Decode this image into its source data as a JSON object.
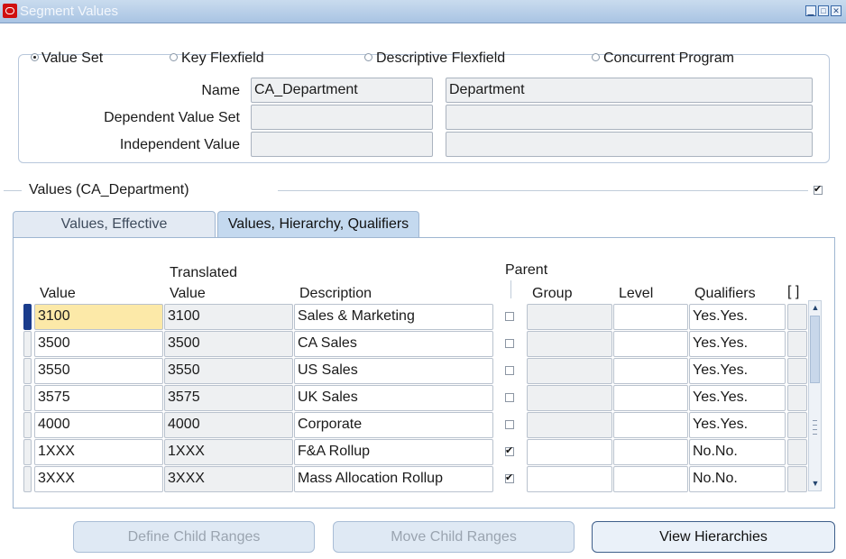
{
  "window": {
    "title": "Segment Values"
  },
  "selector": {
    "options": [
      {
        "label": "Value Set",
        "selected": true
      },
      {
        "label": "Key Flexfield",
        "selected": false
      },
      {
        "label": "Descriptive Flexfield",
        "selected": false
      },
      {
        "label": "Concurrent Program",
        "selected": false
      }
    ],
    "fields": [
      {
        "label": "Name",
        "value": "CA_Department",
        "description": "Department"
      },
      {
        "label": "Dependent Value Set",
        "value": "",
        "description": ""
      },
      {
        "label": "Independent Value",
        "value": "",
        "description": ""
      }
    ]
  },
  "values": {
    "title": "Values (CA_Department)",
    "tabs": [
      {
        "label": "Values, Effective",
        "active": false
      },
      {
        "label": "Values, Hierarchy, Qualifiers",
        "active": true
      }
    ],
    "headers": {
      "value": "Value",
      "translated_1": "Translated",
      "translated_2": "Value",
      "description": "Description",
      "parent": "Parent",
      "group": "Group",
      "level": "Level",
      "qualifiers": "Qualifiers",
      "extra": "[ ]"
    },
    "rows": [
      {
        "value": "3100",
        "translated": "3100",
        "description": "Sales & Marketing",
        "parent": false,
        "group": "",
        "level": "",
        "qualifiers": "Yes.Yes."
      },
      {
        "value": "3500",
        "translated": "3500",
        "description": "CA Sales",
        "parent": false,
        "group": "",
        "level": "",
        "qualifiers": "Yes.Yes."
      },
      {
        "value": "3550",
        "translated": "3550",
        "description": "US Sales",
        "parent": false,
        "group": "",
        "level": "",
        "qualifiers": "Yes.Yes."
      },
      {
        "value": "3575",
        "translated": "3575",
        "description": "UK Sales",
        "parent": false,
        "group": "",
        "level": "",
        "qualifiers": "Yes.Yes."
      },
      {
        "value": "4000",
        "translated": "4000",
        "description": "Corporate",
        "parent": false,
        "group": "",
        "level": "",
        "qualifiers": "Yes.Yes."
      },
      {
        "value": "1XXX",
        "translated": "1XXX",
        "description": "F&A Rollup",
        "parent": true,
        "group": "",
        "level": "",
        "qualifiers": "No.No."
      },
      {
        "value": "3XXX",
        "translated": "3XXX",
        "description": "Mass Allocation Rollup",
        "parent": true,
        "group": "",
        "level": "",
        "qualifiers": "No.No."
      }
    ]
  },
  "buttons": {
    "define_child_ranges": "Define Child Ranges",
    "move_child_ranges": "Move Child Ranges",
    "view_hierarchies": "View Hierarchies"
  },
  "colors": {
    "current_row": "#fce9a8",
    "current_indicator": "#1a3c8c",
    "tab_active": "#c4d9ef"
  }
}
